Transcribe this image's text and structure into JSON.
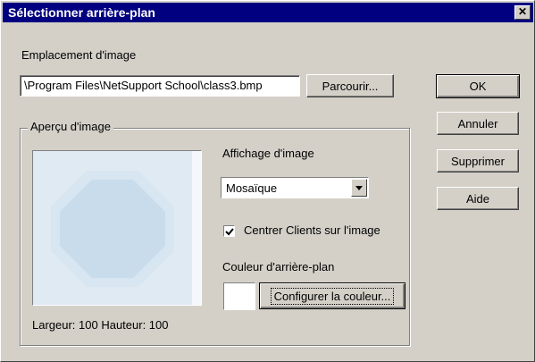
{
  "window": {
    "title": "Sélectionner arrière-plan",
    "close_glyph": "✕"
  },
  "image_location": {
    "label": "Emplacement d'image",
    "value": "\\Program Files\\NetSupport School\\class3.bmp",
    "browse_label": "Parcourir..."
  },
  "preview_group": {
    "title": "Aperçu d'image",
    "dimensions_text": "Largeur: 100   Hauteur: 100"
  },
  "display": {
    "label": "Affichage d'image",
    "selected": "Mosaïque"
  },
  "center_clients": {
    "label": "Centrer Clients sur l'image",
    "checked": true
  },
  "background_color": {
    "label": "Couleur d'arrière-plan",
    "configure_label": "Configurer la couleur...",
    "swatch": "#ffffff"
  },
  "buttons": {
    "ok": "OK",
    "cancel": "Annuler",
    "delete": "Supprimer",
    "help": "Aide"
  },
  "colors": {
    "titlebar": "#000080",
    "face": "#d4d0c8",
    "octagon_fill": "#c8dcec",
    "octagon_border": "#d8e6f1"
  }
}
